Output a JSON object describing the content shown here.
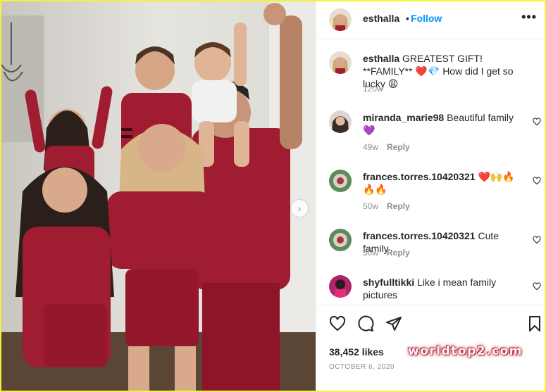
{
  "header": {
    "username": "esthalla",
    "dot": "•",
    "follow_label": "Follow",
    "more_label": "•••"
  },
  "caption": {
    "username": "esthalla",
    "text": "GREATEST GIFT! **FAMILY** ❤️💎 How did I get so lucky 😩",
    "age": "120w"
  },
  "comments": [
    {
      "username": "miranda_marie98",
      "text": "Beautiful family 💜",
      "age": "49w",
      "reply_label": "Reply"
    },
    {
      "username": "frances.torres.10420321",
      "text": "❤️🙌🔥🔥🔥",
      "age": "50w",
      "reply_label": "Reply"
    },
    {
      "username": "frances.torres.10420321",
      "text": "Cute family",
      "age": "50w",
      "reply_label": "Reply"
    },
    {
      "username": "shyfulltikki",
      "text": "Like i mean family pictures",
      "age": "",
      "reply_label": ""
    }
  ],
  "footer": {
    "likes": "38,452 likes",
    "date": "OCTOBER 6, 2020"
  },
  "watermark": "worldtop2.com",
  "icons": {
    "carousel_next": "›"
  },
  "colors": {
    "accent": "#0095f6",
    "outfit": "#a01c30",
    "frame": "#f2f23a"
  }
}
